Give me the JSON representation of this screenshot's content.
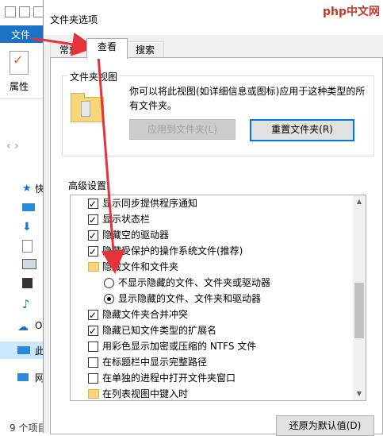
{
  "explorer": {
    "ribbon_tab": "文件",
    "properties_label": "属性",
    "nav_items": [
      {
        "label": "快",
        "icon": "star-icon"
      },
      {
        "label": "",
        "icon": "desktop-icon"
      },
      {
        "label": "",
        "icon": "download-icon"
      },
      {
        "label": "",
        "icon": "document-icon"
      },
      {
        "label": "",
        "icon": "picture-icon"
      },
      {
        "label": "",
        "icon": "video-icon"
      },
      {
        "label": "",
        "icon": "music-icon"
      },
      {
        "label": "O",
        "icon": "cloud-icon"
      },
      {
        "label": "此",
        "icon": "computer-icon"
      },
      {
        "label": "网",
        "icon": "network-icon"
      }
    ],
    "status_text": "9 个项目"
  },
  "dialog": {
    "title": "文件夹选项",
    "watermark": "php中文网",
    "tabs": [
      {
        "label": "常规"
      },
      {
        "label": "查看"
      },
      {
        "label": "搜索"
      }
    ],
    "folder_view": {
      "title": "文件夹视图",
      "description_line1": "你可以将此视图(如详细信息或图标)应用于这种类型的所",
      "description_line2": "有文件夹。",
      "apply_button": "应用到文件夹(L)",
      "reset_button": "重置文件夹(R)"
    },
    "advanced": {
      "title": "高级设置:",
      "items": [
        {
          "type": "checkbox",
          "checked": true,
          "label": "显示同步提供程序通知"
        },
        {
          "type": "checkbox",
          "checked": true,
          "label": "显示状态栏"
        },
        {
          "type": "checkbox",
          "checked": true,
          "label": "隐藏空的驱动器"
        },
        {
          "type": "checkbox",
          "checked": true,
          "label": "隐藏受保护的操作系统文件(推荐)"
        },
        {
          "type": "folder",
          "checked": false,
          "label": "隐藏文件和文件夹"
        },
        {
          "type": "radio",
          "checked": false,
          "label": "不显示隐藏的文件、文件夹或驱动器"
        },
        {
          "type": "radio",
          "checked": true,
          "label": "显示隐藏的文件、文件夹和驱动器"
        },
        {
          "type": "checkbox",
          "checked": true,
          "label": "隐藏文件夹合并冲突"
        },
        {
          "type": "checkbox",
          "checked": true,
          "label": "隐藏已知文件类型的扩展名"
        },
        {
          "type": "checkbox",
          "checked": false,
          "label": "用彩色显示加密或压缩的 NTFS 文件"
        },
        {
          "type": "checkbox",
          "checked": false,
          "label": "在标题栏中显示完整路径"
        },
        {
          "type": "checkbox",
          "checked": false,
          "label": "在单独的进程中打开文件夹窗口"
        },
        {
          "type": "folder",
          "checked": false,
          "label": "在列表视图中键入时"
        }
      ]
    },
    "restore_button": "还原为默认值(D)"
  },
  "colors": {
    "accent": "#1a73c4",
    "arrow": "#e8323a",
    "folder": "#f5d77a"
  }
}
